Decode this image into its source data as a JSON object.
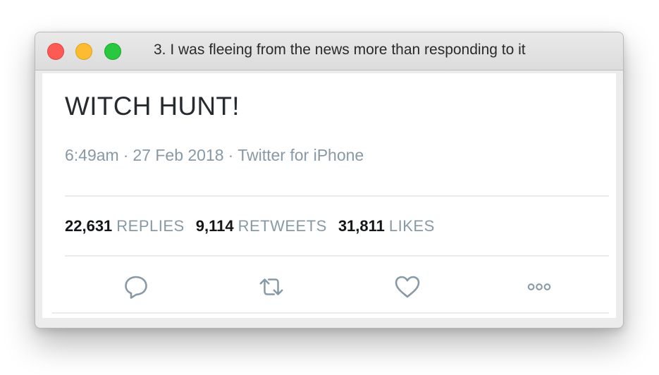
{
  "window": {
    "title": "3. I was fleeing from the news more than responding to it",
    "controls": [
      "close",
      "minimize",
      "zoom"
    ]
  },
  "tweet": {
    "text": "WITCH HUNT!",
    "time": "6:49am",
    "separator": "·",
    "date": "27 Feb 2018",
    "source": "Twitter for iPhone",
    "stats": {
      "replies_count": "22,631",
      "replies_label": "REPLIES",
      "retweets_count": "9,114",
      "retweets_label": "RETWEETS",
      "likes_count": "31,811",
      "likes_label": "LIKES"
    },
    "actions": [
      {
        "icon": "reply-icon"
      },
      {
        "icon": "retweet-icon"
      },
      {
        "icon": "like-icon"
      },
      {
        "icon": "more-icon"
      }
    ]
  },
  "colors": {
    "text_dark": "#14171a",
    "text_muted": "#8899a6",
    "icon_color": "#8899a6",
    "close": "#fc5a55",
    "minimize": "#fdbb2f",
    "zoom": "#29c840"
  }
}
